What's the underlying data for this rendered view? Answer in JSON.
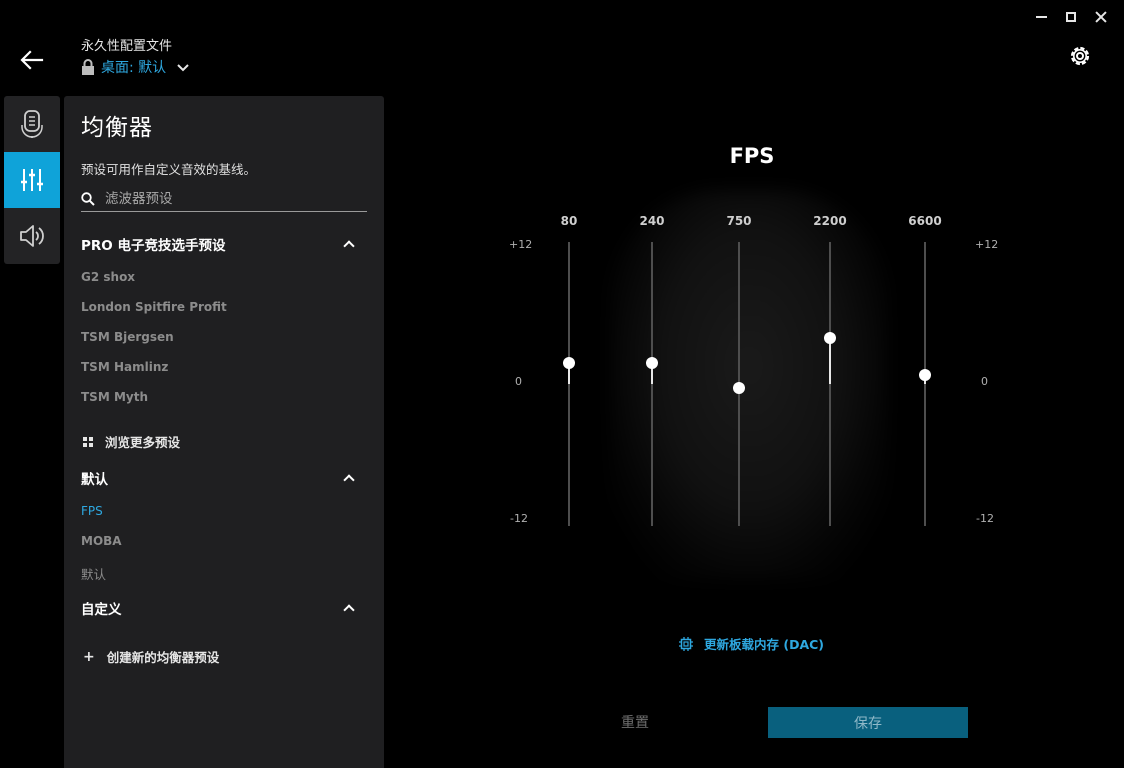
{
  "window": {
    "minimize_icon": "minimize-icon",
    "maximize_icon": "maximize-icon",
    "close_icon": "close-icon"
  },
  "header": {
    "back_icon": "arrow-left-icon",
    "profile_label": "永久性配置文件",
    "profile_name": "桌面: 默认",
    "lock_icon": "lock-icon",
    "dropdown_icon": "chevron-down-icon",
    "settings_icon": "gear-icon"
  },
  "tabs": [
    {
      "icon": "microphone-icon",
      "active": false
    },
    {
      "icon": "equalizer-icon",
      "active": true
    },
    {
      "icon": "speaker-icon",
      "active": false
    }
  ],
  "panel": {
    "title": "均衡器",
    "description": "预设可用作自定义音效的基线。",
    "search_placeholder": "滤波器预设",
    "sections": [
      {
        "label": "PRO 电子竞技选手预设",
        "expanded": true,
        "items": [
          "G2 shox",
          "London Spitfire Profit",
          "TSM Bjergsen",
          "TSM Hamlinz",
          "TSM Myth"
        ]
      },
      {
        "label": "默认",
        "expanded": true,
        "items": [
          "FPS",
          "MOBA",
          "默认"
        ],
        "active_item": "FPS"
      },
      {
        "label": "自定义",
        "expanded": true,
        "items": []
      }
    ],
    "browse_label": "浏览更多预设",
    "create_label": "创建新的均衡器预设"
  },
  "eq": {
    "preset_name": "FPS",
    "scale_top": "+12",
    "scale_mid": "0",
    "scale_bottom": "-12",
    "range_db": [
      -12,
      12
    ],
    "bands": [
      {
        "freq": "80",
        "gain_db": 1.8
      },
      {
        "freq": "240",
        "gain_db": 1.8
      },
      {
        "freq": "750",
        "gain_db": -0.3
      },
      {
        "freq": "2200",
        "gain_db": 3.9
      },
      {
        "freq": "6600",
        "gain_db": 0.8
      }
    ]
  },
  "actions": {
    "dac_label": "更新板载内存 (DAC)",
    "dac_icon": "chip-icon",
    "reset_label": "重置",
    "save_label": "保存"
  },
  "colors": {
    "accent": "#0fa3d9",
    "link": "#2ea8e0",
    "save_bg": "#09607e"
  }
}
